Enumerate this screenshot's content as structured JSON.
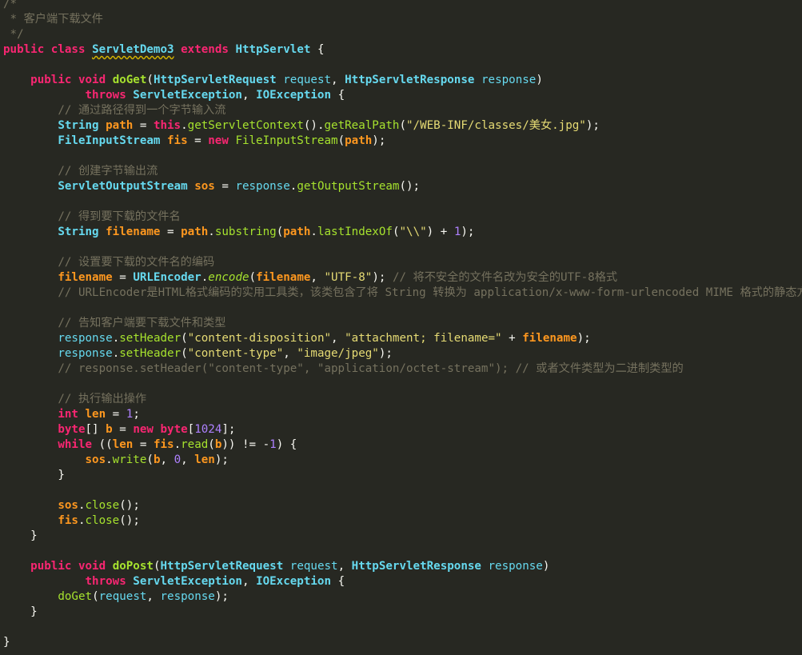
{
  "editor": {
    "background": "#272822",
    "lines": [
      {
        "n": 0,
        "tokens": [
          {
            "t": "/*",
            "c": "cmt"
          }
        ]
      },
      {
        "n": 1,
        "tokens": [
          {
            "t": " * 客户端下载文件",
            "c": "cmt"
          }
        ]
      },
      {
        "n": 2,
        "tokens": [
          {
            "t": " */",
            "c": "cmt"
          }
        ]
      },
      {
        "n": 3,
        "tokens": [
          {
            "t": "public",
            "c": "kw"
          },
          {
            "t": " "
          },
          {
            "t": "class",
            "c": "kw"
          },
          {
            "t": " "
          },
          {
            "t": "ServletDemo3",
            "c": "ty squiggle"
          },
          {
            "t": " "
          },
          {
            "t": "extends",
            "c": "kw"
          },
          {
            "t": " "
          },
          {
            "t": "HttpServlet",
            "c": "ty"
          },
          {
            "t": " {"
          }
        ]
      },
      {
        "n": 5,
        "tokens": [
          {
            "t": "    "
          },
          {
            "t": "public",
            "c": "kw"
          },
          {
            "t": " "
          },
          {
            "t": "void",
            "c": "kw"
          },
          {
            "t": " "
          },
          {
            "t": "doGet",
            "c": "fn"
          },
          {
            "t": "("
          },
          {
            "t": "HttpServletRequest",
            "c": "ty"
          },
          {
            "t": " "
          },
          {
            "t": "request",
            "c": "par"
          },
          {
            "t": ", "
          },
          {
            "t": "HttpServletResponse",
            "c": "ty"
          },
          {
            "t": " "
          },
          {
            "t": "response",
            "c": "par"
          },
          {
            "t": ")"
          }
        ]
      },
      {
        "n": 6,
        "tokens": [
          {
            "t": "            "
          },
          {
            "t": "throws",
            "c": "kw"
          },
          {
            "t": " "
          },
          {
            "t": "ServletException",
            "c": "ty"
          },
          {
            "t": ", "
          },
          {
            "t": "IOException",
            "c": "ty"
          },
          {
            "t": " {"
          }
        ]
      },
      {
        "n": 7,
        "tokens": [
          {
            "t": "        "
          },
          {
            "t": "// 通过路径得到一个字节输入流",
            "c": "cmt"
          }
        ]
      },
      {
        "n": 8,
        "tokens": [
          {
            "t": "        "
          },
          {
            "t": "String",
            "c": "ty"
          },
          {
            "t": " "
          },
          {
            "t": "path",
            "c": "vb"
          },
          {
            "t": " = "
          },
          {
            "t": "this",
            "c": "kw"
          },
          {
            "t": "."
          },
          {
            "t": "getServletContext",
            "c": "mt"
          },
          {
            "t": "()."
          },
          {
            "t": "getRealPath",
            "c": "mt"
          },
          {
            "t": "("
          },
          {
            "t": "\"/WEB-INF/classes/美女.jpg\"",
            "c": "str"
          },
          {
            "t": ");"
          }
        ]
      },
      {
        "n": 9,
        "tokens": [
          {
            "t": "        "
          },
          {
            "t": "FileInputStream",
            "c": "ty"
          },
          {
            "t": " "
          },
          {
            "t": "fis",
            "c": "vb"
          },
          {
            "t": " = "
          },
          {
            "t": "new",
            "c": "kw"
          },
          {
            "t": " "
          },
          {
            "t": "FileInputStream",
            "c": "mt"
          },
          {
            "t": "("
          },
          {
            "t": "path",
            "c": "vb"
          },
          {
            "t": ");"
          }
        ]
      },
      {
        "n": 11,
        "tokens": [
          {
            "t": "        "
          },
          {
            "t": "// 创建字节输出流",
            "c": "cmt"
          }
        ]
      },
      {
        "n": 12,
        "tokens": [
          {
            "t": "        "
          },
          {
            "t": "ServletOutputStream",
            "c": "ty"
          },
          {
            "t": " "
          },
          {
            "t": "sos",
            "c": "vb"
          },
          {
            "t": " = "
          },
          {
            "t": "response",
            "c": "par"
          },
          {
            "t": "."
          },
          {
            "t": "getOutputStream",
            "c": "mt"
          },
          {
            "t": "();"
          }
        ]
      },
      {
        "n": 14,
        "tokens": [
          {
            "t": "        "
          },
          {
            "t": "// 得到要下载的文件名",
            "c": "cmt"
          }
        ]
      },
      {
        "n": 15,
        "tokens": [
          {
            "t": "        "
          },
          {
            "t": "String",
            "c": "ty"
          },
          {
            "t": " "
          },
          {
            "t": "filename",
            "c": "vb"
          },
          {
            "t": " = "
          },
          {
            "t": "path",
            "c": "vb"
          },
          {
            "t": "."
          },
          {
            "t": "substring",
            "c": "mt"
          },
          {
            "t": "("
          },
          {
            "t": "path",
            "c": "vb"
          },
          {
            "t": "."
          },
          {
            "t": "lastIndexOf",
            "c": "mt"
          },
          {
            "t": "("
          },
          {
            "t": "\"\\\\\"",
            "c": "str"
          },
          {
            "t": ") + "
          },
          {
            "t": "1",
            "c": "num"
          },
          {
            "t": ");"
          }
        ]
      },
      {
        "n": 17,
        "tokens": [
          {
            "t": "        "
          },
          {
            "t": "// 设置要下载的文件名的编码",
            "c": "cmt"
          }
        ]
      },
      {
        "n": 18,
        "tokens": [
          {
            "t": "        "
          },
          {
            "t": "filename",
            "c": "vb"
          },
          {
            "t": " = "
          },
          {
            "t": "URLEncoder",
            "c": "ty"
          },
          {
            "t": "."
          },
          {
            "t": "encode",
            "c": "mt ital"
          },
          {
            "t": "("
          },
          {
            "t": "filename",
            "c": "vb"
          },
          {
            "t": ", "
          },
          {
            "t": "\"UTF-8\"",
            "c": "str"
          },
          {
            "t": "); "
          },
          {
            "t": "// 将不安全的文件名改为安全的UTF-8格式",
            "c": "cmt"
          }
        ]
      },
      {
        "n": 19,
        "tokens": [
          {
            "t": "        "
          },
          {
            "t": "// URLEncoder是HTML格式编码的实用工具类，该类包含了将 String 转换为 application/x-www-form-urlencoded MIME 格式的静态方法。",
            "c": "cmt"
          }
        ]
      },
      {
        "n": 21,
        "tokens": [
          {
            "t": "        "
          },
          {
            "t": "// 告知客户端要下载文件和类型",
            "c": "cmt"
          }
        ]
      },
      {
        "n": 22,
        "tokens": [
          {
            "t": "        "
          },
          {
            "t": "response",
            "c": "par"
          },
          {
            "t": "."
          },
          {
            "t": "setHeader",
            "c": "mt"
          },
          {
            "t": "("
          },
          {
            "t": "\"content-disposition\"",
            "c": "str"
          },
          {
            "t": ", "
          },
          {
            "t": "\"attachment; filename=\"",
            "c": "str"
          },
          {
            "t": " + "
          },
          {
            "t": "filename",
            "c": "vb"
          },
          {
            "t": ");"
          }
        ]
      },
      {
        "n": 23,
        "tokens": [
          {
            "t": "        "
          },
          {
            "t": "response",
            "c": "par"
          },
          {
            "t": "."
          },
          {
            "t": "setHeader",
            "c": "mt"
          },
          {
            "t": "("
          },
          {
            "t": "\"content-type\"",
            "c": "str"
          },
          {
            "t": ", "
          },
          {
            "t": "\"image/jpeg\"",
            "c": "str"
          },
          {
            "t": ");"
          }
        ]
      },
      {
        "n": 24,
        "tokens": [
          {
            "t": "        "
          },
          {
            "t": "// response.setHeader(\"content-type\", \"application/octet-stream\"); // 或者文件类型为二进制类型的",
            "c": "cmt"
          }
        ]
      },
      {
        "n": 26,
        "tokens": [
          {
            "t": "        "
          },
          {
            "t": "// 执行输出操作",
            "c": "cmt"
          }
        ]
      },
      {
        "n": 27,
        "tokens": [
          {
            "t": "        "
          },
          {
            "t": "int",
            "c": "kw"
          },
          {
            "t": " "
          },
          {
            "t": "len",
            "c": "vb"
          },
          {
            "t": " = "
          },
          {
            "t": "1",
            "c": "num"
          },
          {
            "t": ";"
          }
        ]
      },
      {
        "n": 28,
        "tokens": [
          {
            "t": "        "
          },
          {
            "t": "byte",
            "c": "kw"
          },
          {
            "t": "[] "
          },
          {
            "t": "b",
            "c": "vb"
          },
          {
            "t": " = "
          },
          {
            "t": "new",
            "c": "kw"
          },
          {
            "t": " "
          },
          {
            "t": "byte",
            "c": "kw"
          },
          {
            "t": "["
          },
          {
            "t": "1024",
            "c": "num"
          },
          {
            "t": "];"
          }
        ]
      },
      {
        "n": 29,
        "tokens": [
          {
            "t": "        "
          },
          {
            "t": "while",
            "c": "kw"
          },
          {
            "t": " (("
          },
          {
            "t": "len",
            "c": "vb"
          },
          {
            "t": " = "
          },
          {
            "t": "fis",
            "c": "vb"
          },
          {
            "t": "."
          },
          {
            "t": "read",
            "c": "mt"
          },
          {
            "t": "("
          },
          {
            "t": "b",
            "c": "vb"
          },
          {
            "t": ")) != -"
          },
          {
            "t": "1",
            "c": "num"
          },
          {
            "t": ") {"
          }
        ]
      },
      {
        "n": 30,
        "tokens": [
          {
            "t": "            "
          },
          {
            "t": "sos",
            "c": "vb"
          },
          {
            "t": "."
          },
          {
            "t": "write",
            "c": "mt"
          },
          {
            "t": "("
          },
          {
            "t": "b",
            "c": "vb"
          },
          {
            "t": ", "
          },
          {
            "t": "0",
            "c": "num"
          },
          {
            "t": ", "
          },
          {
            "t": "len",
            "c": "vb"
          },
          {
            "t": ");"
          }
        ]
      },
      {
        "n": 31,
        "tokens": [
          {
            "t": "        }"
          }
        ]
      },
      {
        "n": 33,
        "tokens": [
          {
            "t": "        "
          },
          {
            "t": "sos",
            "c": "vb"
          },
          {
            "t": "."
          },
          {
            "t": "close",
            "c": "mt"
          },
          {
            "t": "();"
          }
        ]
      },
      {
        "n": 34,
        "tokens": [
          {
            "t": "        "
          },
          {
            "t": "fis",
            "c": "vb"
          },
          {
            "t": "."
          },
          {
            "t": "close",
            "c": "mt"
          },
          {
            "t": "();"
          }
        ]
      },
      {
        "n": 35,
        "tokens": [
          {
            "t": "    }"
          }
        ]
      },
      {
        "n": 37,
        "tokens": [
          {
            "t": "    "
          },
          {
            "t": "public",
            "c": "kw"
          },
          {
            "t": " "
          },
          {
            "t": "void",
            "c": "kw"
          },
          {
            "t": " "
          },
          {
            "t": "doPost",
            "c": "fn"
          },
          {
            "t": "("
          },
          {
            "t": "HttpServletRequest",
            "c": "ty"
          },
          {
            "t": " "
          },
          {
            "t": "request",
            "c": "par"
          },
          {
            "t": ", "
          },
          {
            "t": "HttpServletResponse",
            "c": "ty"
          },
          {
            "t": " "
          },
          {
            "t": "response",
            "c": "par"
          },
          {
            "t": ")"
          }
        ]
      },
      {
        "n": 38,
        "tokens": [
          {
            "t": "            "
          },
          {
            "t": "throws",
            "c": "kw"
          },
          {
            "t": " "
          },
          {
            "t": "ServletException",
            "c": "ty"
          },
          {
            "t": ", "
          },
          {
            "t": "IOException",
            "c": "ty"
          },
          {
            "t": " {"
          }
        ]
      },
      {
        "n": 39,
        "tokens": [
          {
            "t": "        "
          },
          {
            "t": "doGet",
            "c": "mt"
          },
          {
            "t": "("
          },
          {
            "t": "request",
            "c": "par"
          },
          {
            "t": ", "
          },
          {
            "t": "response",
            "c": "par"
          },
          {
            "t": ");"
          }
        ]
      },
      {
        "n": 40,
        "tokens": [
          {
            "t": "    }"
          }
        ]
      },
      {
        "n": 42,
        "tokens": [
          {
            "t": "}"
          }
        ]
      }
    ]
  }
}
